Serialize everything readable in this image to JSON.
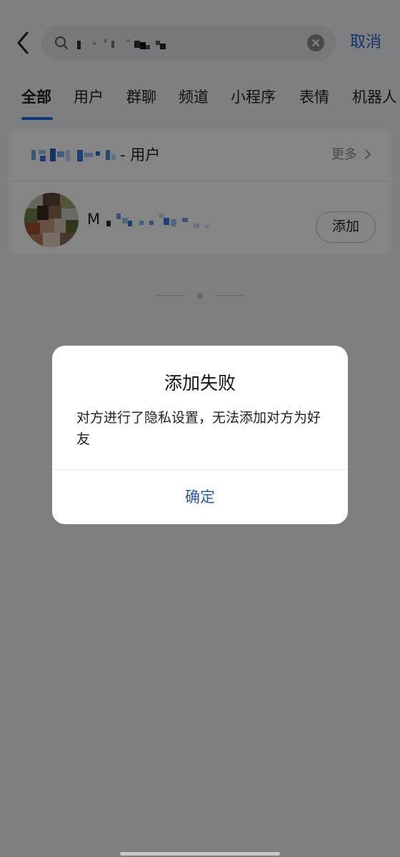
{
  "search": {
    "query": "M",
    "cancel_label": "取消"
  },
  "tabs": [
    {
      "label": "全部",
      "active": true
    },
    {
      "label": "用户"
    },
    {
      "label": "群聊"
    },
    {
      "label": "频道"
    },
    {
      "label": "小程序"
    },
    {
      "label": "表情"
    },
    {
      "label": "机器人"
    }
  ],
  "result_section": {
    "suffix_label": "- 用户",
    "more_label": "更多"
  },
  "user_result": {
    "name_initial": "M",
    "add_label": "添加"
  },
  "dialog": {
    "title": "添加失败",
    "message": "对方进行了隐私设置，无法添加对方为好友",
    "confirm_label": "确定"
  },
  "colors": {
    "accent": "#2a63c9",
    "tab_indicator": "#1f6fe5",
    "dialog_button": "#2a5aa8"
  }
}
